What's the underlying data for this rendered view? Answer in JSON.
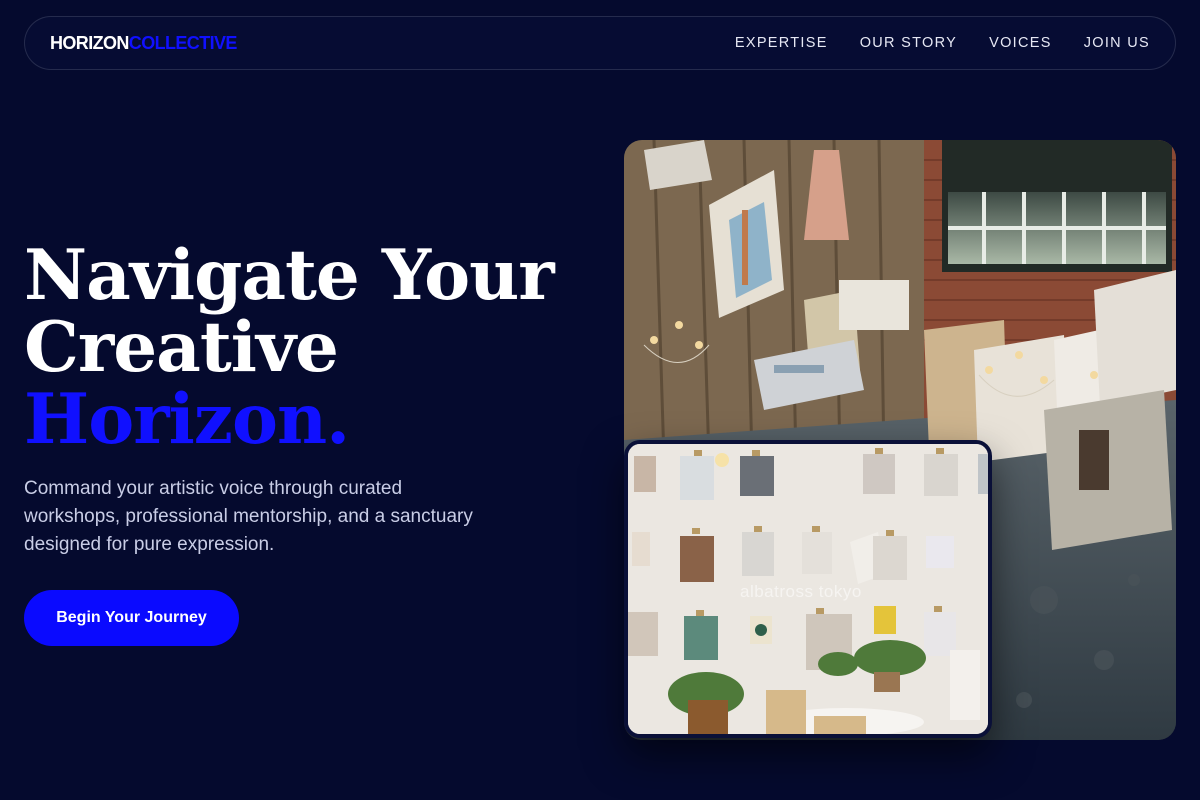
{
  "brand": {
    "part1": "HORIZON",
    "part2": "COLLECTIVE"
  },
  "nav": {
    "items": [
      "EXPERTISE",
      "OUR STORY",
      "VOICES",
      "JOIN US"
    ]
  },
  "hero": {
    "headline_line1": "Navigate Your",
    "headline_line2": "Creative",
    "headline_accent": "Horizon.",
    "subtitle": "Command your artistic voice through curated workshops, professional mentorship, and a sanctuary designed for pure expression.",
    "cta_label": "Begin Your Journey"
  },
  "images": {
    "inset_watermark": "albatross tokyo"
  },
  "colors": {
    "background": "#050a2e",
    "accent": "#1010ff",
    "cta_background": "#0a0aff",
    "text_primary": "#ffffff",
    "text_muted": "#c9cde6"
  }
}
